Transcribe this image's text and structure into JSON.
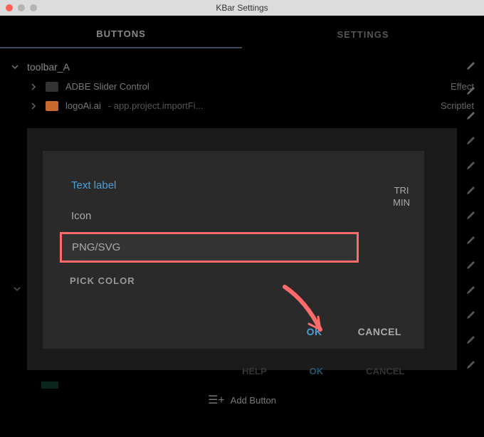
{
  "window": {
    "title": "KBar Settings"
  },
  "tabs": {
    "buttons": "BUTTONS",
    "settings": "SETTINGS"
  },
  "toolbar": {
    "name": "toolbar_A",
    "items": [
      {
        "name": "ADBE Slider Control",
        "type": "Effect"
      },
      {
        "name": "logoAi.ai",
        "desc": " - app.project.importFi...",
        "type": "Scriptlet"
      }
    ]
  },
  "dialog": {
    "options": {
      "text_label": "Text label",
      "icon": "Icon",
      "png_svg": "PNG/SVG"
    },
    "trimin": "TRI\nMIN",
    "pick_color": "PICK COLOR",
    "ok": "OK",
    "cancel": "CANCEL"
  },
  "bottom": {
    "help": "HELP",
    "ok": "OK",
    "cancel": "CANCEL"
  },
  "add_button": "Add Button"
}
